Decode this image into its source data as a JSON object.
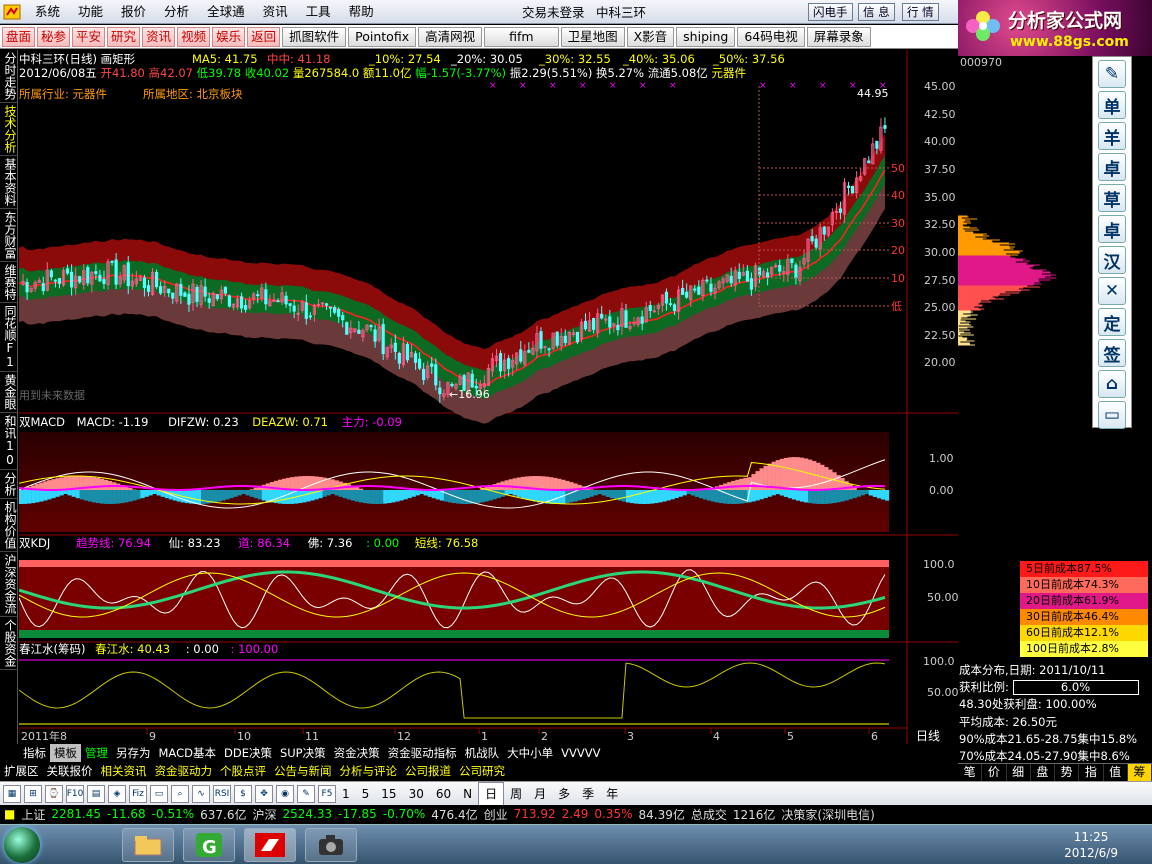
{
  "menu": {
    "items": [
      "系统",
      "功能",
      "报价",
      "分析",
      "全球通",
      "资讯",
      "工具",
      "帮助"
    ],
    "status": "交易未登录",
    "stock": "中科三环",
    "right_buttons": [
      "闪电手",
      "信 息",
      "行 情"
    ]
  },
  "toolbar": {
    "red_buttons": [
      "盘面",
      "秘参",
      "平安",
      "研究",
      "资讯",
      "视频",
      "娱乐",
      "返回"
    ],
    "buttons": [
      "抓图软件",
      "Pointofix",
      "高清网视",
      "fifm",
      "卫星地图",
      "X影音",
      "shiping",
      "64码电视",
      "屏幕录象"
    ]
  },
  "brand": {
    "title": "分析家公式网",
    "url": "www.88gs.com",
    "code": "000970"
  },
  "left_tabs": [
    "分时走势",
    "技术分析",
    "基本资料",
    "东方财富",
    "维赛特",
    "同花顺F1",
    "黄金眼",
    "和讯10",
    "分析",
    "机构价值",
    "沪深资金流",
    "个股资金"
  ],
  "chart_header": {
    "name": "中科三环(日线) 画矩形",
    "ma5": "MA5: 41.75",
    "mid": "中中: 41.18",
    "p10": "_10%: 27.54",
    "p20": "_20%: 30.05",
    "p30": "_30%: 32.55",
    "p40": "_40%: 35.06",
    "p50": "_50%: 37.56",
    "date": "2012/06/08五",
    "open_label": "开",
    "open": "41.80",
    "high_label": "高",
    "high": "42.07",
    "low_label": "低",
    "low": "39.78",
    "close_label": "收",
    "close": "40.02",
    "volume": "量267584.0",
    "amount": "额11.0亿",
    "change": "幅-1.57(-3.77%)",
    "amplitude": "振2.29(5.51%)",
    "turnover": "换5.27%",
    "float": "流通5.08亿",
    "sector": "元器件",
    "industry": "所属行业: 元器件",
    "region": "所属地区: 北京板块",
    "footnote": "用到未来数据",
    "max_label": "44.95",
    "min_label": "←16.96"
  },
  "price_axis": [
    "45.00",
    "42.50",
    "40.00",
    "37.50",
    "35.00",
    "32.50",
    "30.00",
    "27.50",
    "25.00",
    "22.50",
    "20.00"
  ],
  "level_labels": [
    "50",
    "40",
    "30",
    "20",
    "10",
    "低"
  ],
  "macd_header": {
    "name": "双MACD",
    "macd": "MACD: -1.19",
    "difzw": "DIFZW: 0.23",
    "deazw": "DEAZW: 0.71",
    "zhuli": "主力: -0.09"
  },
  "macd_axis": [
    "1.00",
    "0.00"
  ],
  "kdj_header": {
    "name": "双KDJ",
    "trend": "趋势线: 76.94",
    "xian": "仙: 83.23",
    "dao": "道: 86.34",
    "fo": "佛: 7.36",
    "zero": ": 0.00",
    "short": "短线: 76.58"
  },
  "kdj_axis": [
    "100.0",
    "50.00"
  ],
  "chip_header": {
    "name": "春江水(筹码)",
    "cjs": "春江水: 40.43",
    "zero": ": 0.00",
    "hundred": ": 100.00"
  },
  "chip_axis": [
    "100.0",
    "50.00"
  ],
  "date_axis": [
    "2011年8",
    "9",
    "10",
    "11",
    "12",
    "1",
    "2",
    "3",
    "4",
    "5",
    "6"
  ],
  "period_label": "日线",
  "cost_rows": [
    {
      "label": "5日前成本87.5%",
      "color": "#ff1a1a"
    },
    {
      "label": "10日前成本74.3%",
      "color": "#ff6a5a"
    },
    {
      "label": "20日前成本61.9%",
      "color": "#e01888"
    },
    {
      "label": "30日前成本46.4%",
      "color": "#ff8a00"
    },
    {
      "label": "60日前成本12.1%",
      "color": "#ffd800"
    },
    {
      "label": "100日前成本2.8%",
      "color": "#ffff40"
    }
  ],
  "dist_info": {
    "date": "成本分布,日期: 2011/10/11",
    "ratio_label": "获利比例:",
    "ratio": "6.0%",
    "profit": "48.30处获利盘: 100.00%",
    "avg": "平均成本: 26.50元",
    "c90": "90%成本21.65-28.75集中15.8%",
    "c70": "70%成本24.05-27.90集中8.6%"
  },
  "right_tabs": [
    "笔",
    "价",
    "细",
    "盘",
    "势",
    "指",
    "值",
    "筹"
  ],
  "tool_buttons": [
    "✎",
    "单",
    "羊",
    "卓",
    "草",
    "卓",
    "汉",
    "✕",
    "定",
    "签",
    "⌂",
    "▭"
  ],
  "bottom_tabs": [
    "指标",
    "模板",
    "管理",
    "另存为",
    "MACD基本",
    "DDE决策",
    "SUP决策",
    "资金决策",
    "资金驱动指标",
    "机战队",
    "大中小单",
    "VVVVV"
  ],
  "links": [
    "扩展区",
    "关联报价",
    "相关资讯",
    "资金驱动力",
    "个股点评",
    "公告与新闻",
    "分析与评论",
    "公司报道",
    "公司研究"
  ],
  "period_buttons": [
    "1",
    "5",
    "15",
    "30",
    "60",
    "N",
    "日",
    "周",
    "月",
    "多",
    "季",
    "年"
  ],
  "ticker": {
    "sh_name": "上证",
    "sh_val": "2281.45",
    "sh_chg": "-11.68",
    "sh_pct": "-0.51%",
    "sh_amt": "637.6亿",
    "sz_name": "沪深",
    "sz_val": "2524.33",
    "sz_chg": "-17.85",
    "sz_pct": "-0.70%",
    "sz_amt": "476.4亿",
    "cy_name": "创业",
    "cy_val": "713.92",
    "cy_chg": "2.49",
    "cy_pct": "0.35%",
    "cy_amt": "84.39亿",
    "total": "总成交",
    "total_amt": "1216亿",
    "broker": "决策家(深圳电信)"
  },
  "clock": {
    "time": "11:25",
    "date": "2012/6/9"
  },
  "chart_data": {
    "type": "line",
    "title": "中科三环(日线)",
    "ylim": [
      16.96,
      44.95
    ],
    "x": [
      "2011年8",
      "9",
      "10",
      "11",
      "12",
      "1",
      "2",
      "3",
      "4",
      "5",
      "6"
    ],
    "series": [
      {
        "name": "收",
        "values": [
          27.5,
          28.5,
          26.5,
          26,
          23.5,
          18,
          22.5,
          24.5,
          27,
          29,
          41
        ]
      }
    ]
  }
}
